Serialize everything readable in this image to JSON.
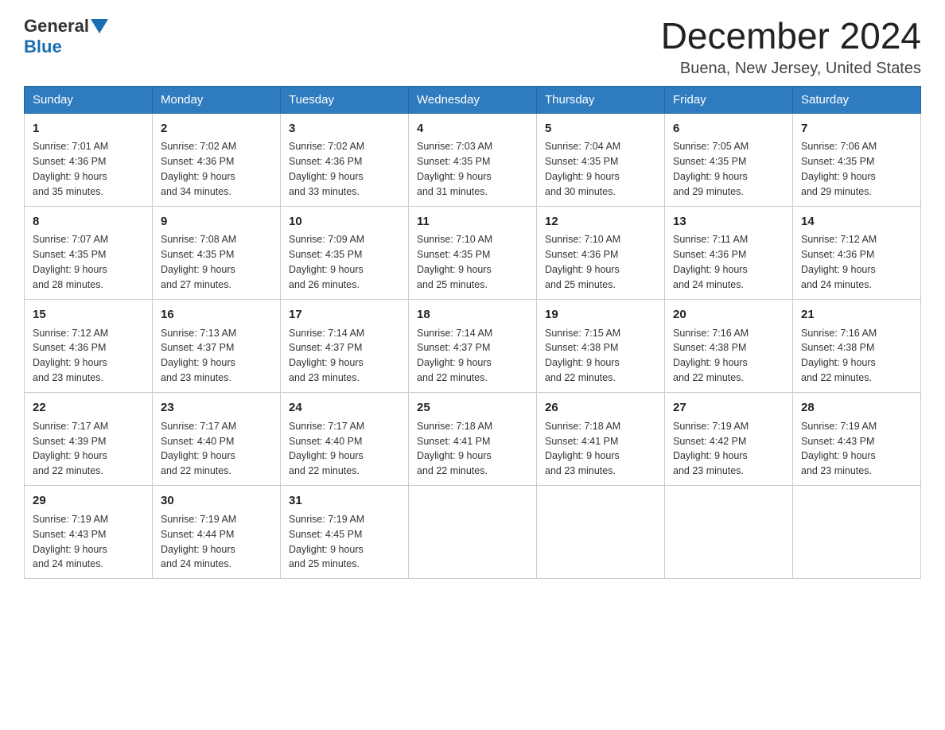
{
  "header": {
    "logo_general": "General",
    "logo_blue": "Blue",
    "month_title": "December 2024",
    "location": "Buena, New Jersey, United States"
  },
  "days_of_week": [
    "Sunday",
    "Monday",
    "Tuesday",
    "Wednesday",
    "Thursday",
    "Friday",
    "Saturday"
  ],
  "weeks": [
    [
      {
        "day": "1",
        "sunrise": "7:01 AM",
        "sunset": "4:36 PM",
        "daylight": "9 hours and 35 minutes."
      },
      {
        "day": "2",
        "sunrise": "7:02 AM",
        "sunset": "4:36 PM",
        "daylight": "9 hours and 34 minutes."
      },
      {
        "day": "3",
        "sunrise": "7:02 AM",
        "sunset": "4:36 PM",
        "daylight": "9 hours and 33 minutes."
      },
      {
        "day": "4",
        "sunrise": "7:03 AM",
        "sunset": "4:35 PM",
        "daylight": "9 hours and 31 minutes."
      },
      {
        "day": "5",
        "sunrise": "7:04 AM",
        "sunset": "4:35 PM",
        "daylight": "9 hours and 30 minutes."
      },
      {
        "day": "6",
        "sunrise": "7:05 AM",
        "sunset": "4:35 PM",
        "daylight": "9 hours and 29 minutes."
      },
      {
        "day": "7",
        "sunrise": "7:06 AM",
        "sunset": "4:35 PM",
        "daylight": "9 hours and 29 minutes."
      }
    ],
    [
      {
        "day": "8",
        "sunrise": "7:07 AM",
        "sunset": "4:35 PM",
        "daylight": "9 hours and 28 minutes."
      },
      {
        "day": "9",
        "sunrise": "7:08 AM",
        "sunset": "4:35 PM",
        "daylight": "9 hours and 27 minutes."
      },
      {
        "day": "10",
        "sunrise": "7:09 AM",
        "sunset": "4:35 PM",
        "daylight": "9 hours and 26 minutes."
      },
      {
        "day": "11",
        "sunrise": "7:10 AM",
        "sunset": "4:35 PM",
        "daylight": "9 hours and 25 minutes."
      },
      {
        "day": "12",
        "sunrise": "7:10 AM",
        "sunset": "4:36 PM",
        "daylight": "9 hours and 25 minutes."
      },
      {
        "day": "13",
        "sunrise": "7:11 AM",
        "sunset": "4:36 PM",
        "daylight": "9 hours and 24 minutes."
      },
      {
        "day": "14",
        "sunrise": "7:12 AM",
        "sunset": "4:36 PM",
        "daylight": "9 hours and 24 minutes."
      }
    ],
    [
      {
        "day": "15",
        "sunrise": "7:12 AM",
        "sunset": "4:36 PM",
        "daylight": "9 hours and 23 minutes."
      },
      {
        "day": "16",
        "sunrise": "7:13 AM",
        "sunset": "4:37 PM",
        "daylight": "9 hours and 23 minutes."
      },
      {
        "day": "17",
        "sunrise": "7:14 AM",
        "sunset": "4:37 PM",
        "daylight": "9 hours and 23 minutes."
      },
      {
        "day": "18",
        "sunrise": "7:14 AM",
        "sunset": "4:37 PM",
        "daylight": "9 hours and 22 minutes."
      },
      {
        "day": "19",
        "sunrise": "7:15 AM",
        "sunset": "4:38 PM",
        "daylight": "9 hours and 22 minutes."
      },
      {
        "day": "20",
        "sunrise": "7:16 AM",
        "sunset": "4:38 PM",
        "daylight": "9 hours and 22 minutes."
      },
      {
        "day": "21",
        "sunrise": "7:16 AM",
        "sunset": "4:38 PM",
        "daylight": "9 hours and 22 minutes."
      }
    ],
    [
      {
        "day": "22",
        "sunrise": "7:17 AM",
        "sunset": "4:39 PM",
        "daylight": "9 hours and 22 minutes."
      },
      {
        "day": "23",
        "sunrise": "7:17 AM",
        "sunset": "4:40 PM",
        "daylight": "9 hours and 22 minutes."
      },
      {
        "day": "24",
        "sunrise": "7:17 AM",
        "sunset": "4:40 PM",
        "daylight": "9 hours and 22 minutes."
      },
      {
        "day": "25",
        "sunrise": "7:18 AM",
        "sunset": "4:41 PM",
        "daylight": "9 hours and 22 minutes."
      },
      {
        "day": "26",
        "sunrise": "7:18 AM",
        "sunset": "4:41 PM",
        "daylight": "9 hours and 23 minutes."
      },
      {
        "day": "27",
        "sunrise": "7:19 AM",
        "sunset": "4:42 PM",
        "daylight": "9 hours and 23 minutes."
      },
      {
        "day": "28",
        "sunrise": "7:19 AM",
        "sunset": "4:43 PM",
        "daylight": "9 hours and 23 minutes."
      }
    ],
    [
      {
        "day": "29",
        "sunrise": "7:19 AM",
        "sunset": "4:43 PM",
        "daylight": "9 hours and 24 minutes."
      },
      {
        "day": "30",
        "sunrise": "7:19 AM",
        "sunset": "4:44 PM",
        "daylight": "9 hours and 24 minutes."
      },
      {
        "day": "31",
        "sunrise": "7:19 AM",
        "sunset": "4:45 PM",
        "daylight": "9 hours and 25 minutes."
      },
      null,
      null,
      null,
      null
    ]
  ]
}
